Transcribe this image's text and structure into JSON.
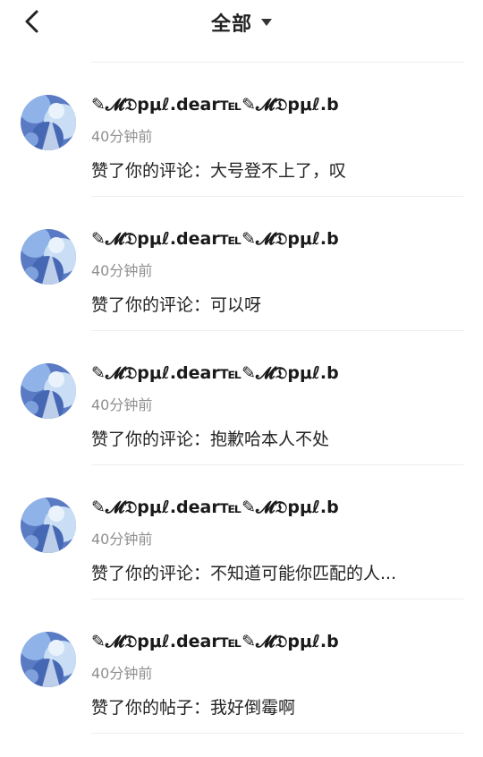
{
  "header": {
    "title": "全部"
  },
  "notifications": [
    {
      "username": "✎𝓜𝔇pμℓ.dear℡✎𝓜𝔇pμℓ.b",
      "time": "40分钟前",
      "message": "赞了你的评论：大号登不上了，叹"
    },
    {
      "username": "✎𝓜𝔇pμℓ.dear℡✎𝓜𝔇pμℓ.b",
      "time": "40分钟前",
      "message": "赞了你的评论：可以呀"
    },
    {
      "username": "✎𝓜𝔇pμℓ.dear℡✎𝓜𝔇pμℓ.b",
      "time": "40分钟前",
      "message": "赞了你的评论：抱歉哈本人不处"
    },
    {
      "username": "✎𝓜𝔇pμℓ.dear℡✎𝓜𝔇pμℓ.b",
      "time": "40分钟前",
      "message": "赞了你的评论：不知道可能你匹配的人..."
    },
    {
      "username": "✎𝓜𝔇pμℓ.dear℡✎𝓜𝔇pμℓ.b",
      "time": "40分钟前",
      "message": "赞了你的帖子：我好倒霉啊"
    }
  ]
}
